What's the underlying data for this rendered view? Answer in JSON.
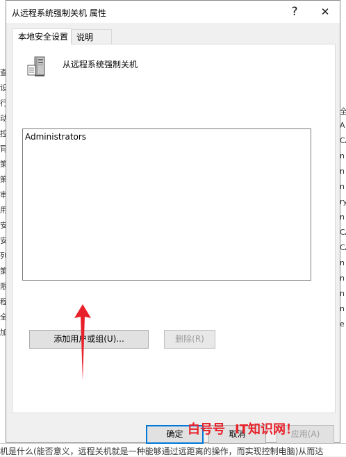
{
  "window": {
    "title": "从远程系统强制关机 属性",
    "help_glyph": "?",
    "close_glyph": "✕"
  },
  "tabs": [
    {
      "label": "本地安全设置",
      "active": true
    },
    {
      "label": "说明",
      "active": false
    }
  ],
  "policy": {
    "icon": "computer-tower-icon",
    "name": "从远程系统强制关机"
  },
  "members": [
    "Administrators"
  ],
  "buttons": {
    "add": "添加用户或组(U)...",
    "remove": "删除(R)",
    "ok": "确定",
    "cancel": "取消",
    "apply": "应用(A)"
  },
  "watermark": {
    "part1": "白号号",
    "part2": "IT知识网！"
  },
  "background": {
    "left_glyphs": [
      "查",
      "设",
      "行",
      "动",
      "控",
      "肎",
      "策",
      "策",
      "审",
      "用",
      "安",
      "安",
      "列",
      "策",
      "限",
      "程",
      "全",
      "加"
    ],
    "right_glyphs": [
      "全设",
      "A",
      "CA",
      "n",
      "n",
      "n",
      "ry",
      "n",
      "CA",
      "CA",
      "n",
      "n",
      "n",
      "n",
      "e"
    ],
    "bottom_text": "机是什么(能否意义，远程关机就是一种能够通过远距离的操作，而实现控制电脑)从而达"
  },
  "colors": {
    "focus_border": "#0078d7",
    "arrow": "#e8202a",
    "watermark": "#e8202a"
  }
}
